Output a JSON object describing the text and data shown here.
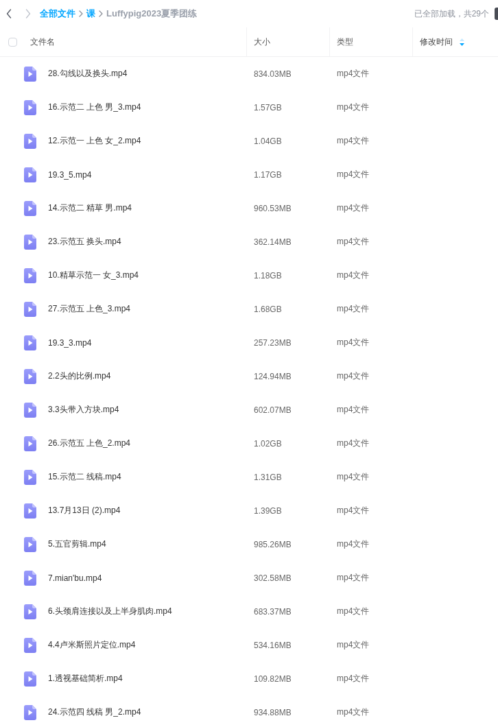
{
  "toolbar": {
    "nav": [
      {
        "kind": "back",
        "disabled": false
      },
      {
        "kind": "forward",
        "disabled": true
      }
    ],
    "breadcrumb": [
      {
        "label": "全部文件",
        "current": false
      },
      {
        "label": "课",
        "current": false
      },
      {
        "label": "Luffypig2023夏季团练",
        "current": true
      }
    ],
    "status": "已全部加载，共29个"
  },
  "table": {
    "select_all": {
      "checked": false
    },
    "columns": [
      {
        "label": "文件名",
        "sorted": false
      },
      {
        "label": "大小",
        "sorted": false
      },
      {
        "label": "类型",
        "sorted": false
      },
      {
        "label": "修改时间",
        "sorted": true,
        "descending": true
      }
    ],
    "rows": [
      {
        "name": "28.勾线以及换头.mp4",
        "size": "834.03MB",
        "type": "mp4文件"
      },
      {
        "name": "16.示范二 上色 男_3.mp4",
        "size": "1.57GB",
        "type": "mp4文件"
      },
      {
        "name": "12.示范一 上色 女_2.mp4",
        "size": "1.04GB",
        "type": "mp4文件"
      },
      {
        "name": "19.3_5.mp4",
        "size": "1.17GB",
        "type": "mp4文件"
      },
      {
        "name": "14.示范二 精草 男.mp4",
        "size": "960.53MB",
        "type": "mp4文件"
      },
      {
        "name": "23.示范五 换头.mp4",
        "size": "362.14MB",
        "type": "mp4文件"
      },
      {
        "name": "10.精草示范一 女_3.mp4",
        "size": "1.18GB",
        "type": "mp4文件"
      },
      {
        "name": "27.示范五 上色_3.mp4",
        "size": "1.68GB",
        "type": "mp4文件"
      },
      {
        "name": "19.3_3.mp4",
        "size": "257.23MB",
        "type": "mp4文件"
      },
      {
        "name": "2.2头的比例.mp4",
        "size": "124.94MB",
        "type": "mp4文件"
      },
      {
        "name": "3.3头带入方块.mp4",
        "size": "602.07MB",
        "type": "mp4文件"
      },
      {
        "name": "26.示范五 上色_2.mp4",
        "size": "1.02GB",
        "type": "mp4文件"
      },
      {
        "name": "15.示范二 线稿.mp4",
        "size": "1.31GB",
        "type": "mp4文件"
      },
      {
        "name": "13.7月13日 (2).mp4",
        "size": "1.39GB",
        "type": "mp4文件"
      },
      {
        "name": "5.五官剪辑.mp4",
        "size": "985.26MB",
        "type": "mp4文件"
      },
      {
        "name": "7.mian'bu.mp4",
        "size": "302.58MB",
        "type": "mp4文件"
      },
      {
        "name": "6.头颈肩连接以及上半身肌肉.mp4",
        "size": "683.37MB",
        "type": "mp4文件"
      },
      {
        "name": "4.4卢米斯照片定位.mp4",
        "size": "534.16MB",
        "type": "mp4文件"
      },
      {
        "name": "1.透视基础简析.mp4",
        "size": "109.82MB",
        "type": "mp4文件"
      },
      {
        "name": "24.示范四 线稿 男_2.mp4",
        "size": "934.88MB",
        "type": "mp4文件"
      }
    ]
  }
}
